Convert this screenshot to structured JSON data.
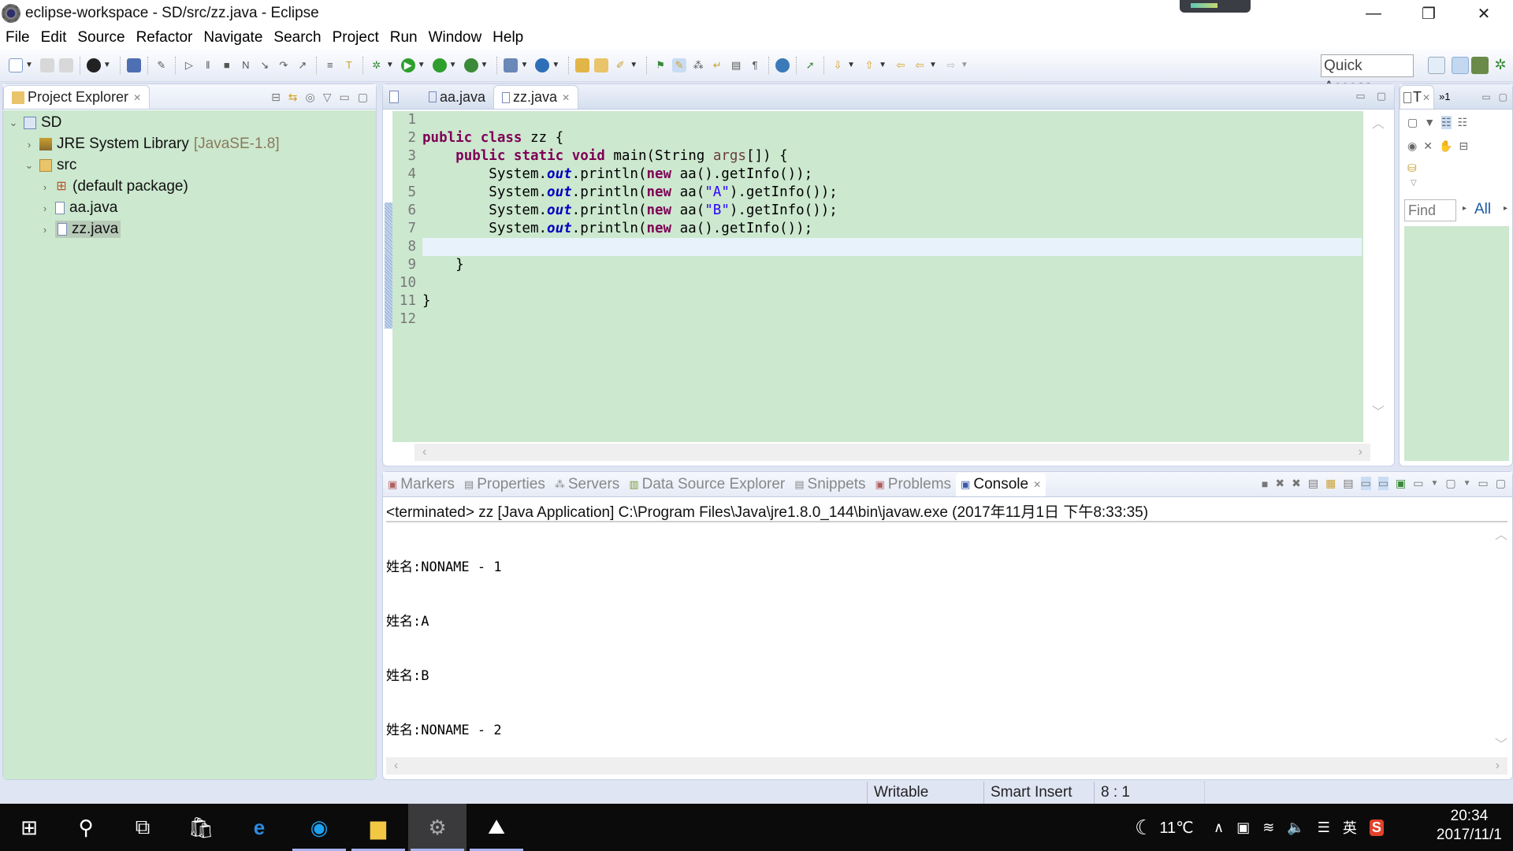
{
  "window": {
    "title": "eclipse-workspace - SD/src/zz.java - Eclipse",
    "controls": {
      "minimize": "—",
      "restore": "❐",
      "close": "✕"
    }
  },
  "menu": [
    "File",
    "Edit",
    "Source",
    "Refactor",
    "Navigate",
    "Search",
    "Project",
    "Run",
    "Window",
    "Help"
  ],
  "toolbar": {
    "quick_access_label": "Quick Access",
    "icons": [
      "new-icon",
      "save-icon",
      "save-all-icon",
      "profile-icon",
      "terminal-icon",
      "skip-breakpoints-icon",
      "resume-icon",
      "suspend-icon",
      "terminate-icon",
      "disconnect-icon",
      "step-into-icon",
      "step-over-icon",
      "step-return-icon",
      "use-step-filters-icon",
      "toggle-mark-icon",
      "debug-icon",
      "run-icon",
      "run-server-icon",
      "profile-server-icon",
      "new-java-project-icon",
      "new-class-icon",
      "open-type-icon",
      "open-task-icon",
      "search-icon",
      "toggle-breadcrumb-icon",
      "mark-occurrences-icon",
      "block-selection-icon",
      "word-wrap-icon",
      "show-whitespace-icon",
      "show-paragraph-icon",
      "open-web-browser-icon",
      "launch-icon",
      "next-annotation-icon",
      "previous-annotation-icon",
      "last-edit-icon",
      "back-icon",
      "forward-icon"
    ],
    "perspectives": [
      "open-perspective-icon",
      "jee-perspective-icon",
      "java-perspective-icon",
      "debug-perspective-icon"
    ]
  },
  "project_explorer": {
    "title": "Project Explorer",
    "tree": [
      {
        "label": "SD",
        "level": 0,
        "expanded": true,
        "icon": "project-icon"
      },
      {
        "label": "JRE System Library",
        "suffix": "[JavaSE-1.8]",
        "level": 1,
        "expanded": false,
        "icon": "library-icon"
      },
      {
        "label": "src",
        "level": 1,
        "expanded": true,
        "icon": "source-folder-icon"
      },
      {
        "label": "(default package)",
        "level": 2,
        "expanded": false,
        "icon": "package-icon"
      },
      {
        "label": "aa.java",
        "level": 2,
        "expanded": false,
        "icon": "java-file-icon"
      },
      {
        "label": "zz.java",
        "level": 2,
        "expanded": false,
        "icon": "java-file-icon",
        "selected": true
      }
    ]
  },
  "editor": {
    "tabs": [
      {
        "label": "aa.java",
        "active": false
      },
      {
        "label": "zz.java",
        "active": true
      }
    ],
    "current_line": 8,
    "lines": [
      {
        "n": "1",
        "code": ""
      },
      {
        "n": "2",
        "code": "public class zz {"
      },
      {
        "n": "3",
        "code": "    public static void main(String args[]) {"
      },
      {
        "n": "4",
        "code": "        System.out.println(new aa().getInfo());"
      },
      {
        "n": "5",
        "code": "        System.out.println(new aa(\"A\").getInfo());"
      },
      {
        "n": "6",
        "code": "        System.out.println(new aa(\"B\").getInfo());"
      },
      {
        "n": "7",
        "code": "        System.out.println(new aa().getInfo());"
      },
      {
        "n": "8",
        "code": ""
      },
      {
        "n": "9",
        "code": "    }"
      },
      {
        "n": "10",
        "code": ""
      },
      {
        "n": "11",
        "code": "}"
      },
      {
        "n": "12",
        "code": ""
      }
    ]
  },
  "outline": {
    "tab_label": "T",
    "overflow_label": "»1",
    "find_placeholder": "Find",
    "all_label": "All"
  },
  "console": {
    "tabs": [
      {
        "label": "Markers",
        "icon": "markers-icon"
      },
      {
        "label": "Properties",
        "icon": "properties-icon"
      },
      {
        "label": "Servers",
        "icon": "servers-icon"
      },
      {
        "label": "Data Source Explorer",
        "icon": "data-source-icon"
      },
      {
        "label": "Snippets",
        "icon": "snippets-icon"
      },
      {
        "label": "Problems",
        "icon": "problems-icon"
      },
      {
        "label": "Console",
        "icon": "console-icon",
        "active": true
      }
    ],
    "header": "<terminated> zz [Java Application] C:\\Program Files\\Java\\jre1.8.0_144\\bin\\javaw.exe (2017年11月1日 下午8:33:35)",
    "output": [
      "姓名:NONAME - 1",
      "姓名:A",
      "姓名:B",
      "姓名:NONAME - 2"
    ]
  },
  "statusbar": {
    "writable": "Writable",
    "insert_mode": "Smart Insert",
    "position": "8 : 1"
  },
  "taskbar": {
    "apps": [
      "start-icon",
      "search-icon",
      "task-view-icon",
      "store-icon",
      "ie-icon",
      "qq-browser-icon",
      "file-explorer-icon",
      "eclipse-icon",
      "photos-icon"
    ],
    "weather": "11℃",
    "ime": "英",
    "time": "20:34",
    "date": "2017/11/1"
  }
}
